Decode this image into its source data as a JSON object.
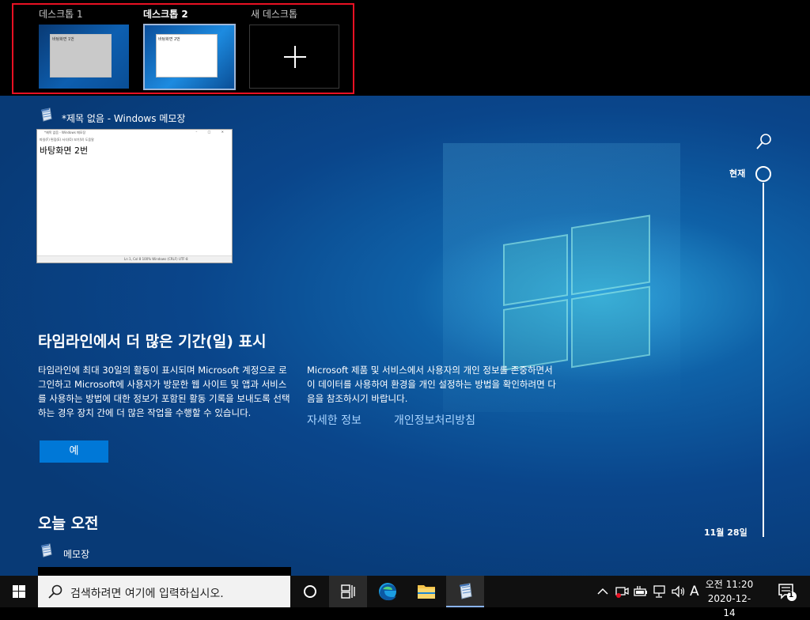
{
  "desktops": [
    {
      "label": "데스크톱 1",
      "window_label": "바탕화면 1번",
      "active": false
    },
    {
      "label": "데스크톱 2",
      "window_label": "바탕화면 2번",
      "active": true
    }
  ],
  "new_desktop": {
    "label": "새 데스크톱"
  },
  "activity_window": {
    "app_title": "*제목 없음 - Windows 메모장",
    "mini_titlebar": "*제목 없음 - Windows 메모장",
    "mini_menu": "파일(F)   편집(E)   서식(O)   보기(V)   도움말",
    "content": "바탕화면 2번",
    "mini_status": "Ln 1, Col 8        100%    Windows (CRLF)     UTF-8"
  },
  "timeline_prompt": {
    "heading": "타임라인에서 더 많은 기간(일) 표시",
    "body": "타임라인에 최대 30일의 활동이 표시되며 Microsoft 계정으로 로그인하고 Microsoft에 사용자가 방문한 웹 사이트 및 앱과 서비스를 사용하는 방법에 대한 정보가 포함된 활동 기록을 보내도록 선택하는 경우 장치 간에 더 많은 작업을 수행할 수 있습니다.",
    "yes_label": "예",
    "privacy_text": "Microsoft 제품 및 서비스에서 사용자의 개인 정보를 존중하면서 이 데이터를 사용하여 환경을 개인 설정하는 방법을 확인하려면 다음을 참조하시기 바랍니다.",
    "link_more": "자세한 정보",
    "link_privacy": "개인정보처리방침"
  },
  "today_section": {
    "heading": "오늘 오전",
    "item_label": "메모장"
  },
  "timeline_scrubber": {
    "current_label": "현재",
    "date_label": "11월 28일"
  },
  "taskbar": {
    "search_placeholder": "검색하려면 여기에 입력하십시오.",
    "ime_label": "A",
    "clock_time": "오전 11:20",
    "clock_date": "2020-12-14",
    "notification_count": "1"
  },
  "colors": {
    "highlight_border": "#e81123",
    "accent": "#0078d7",
    "link": "#a8d4ff",
    "taskbar": "#101010"
  }
}
